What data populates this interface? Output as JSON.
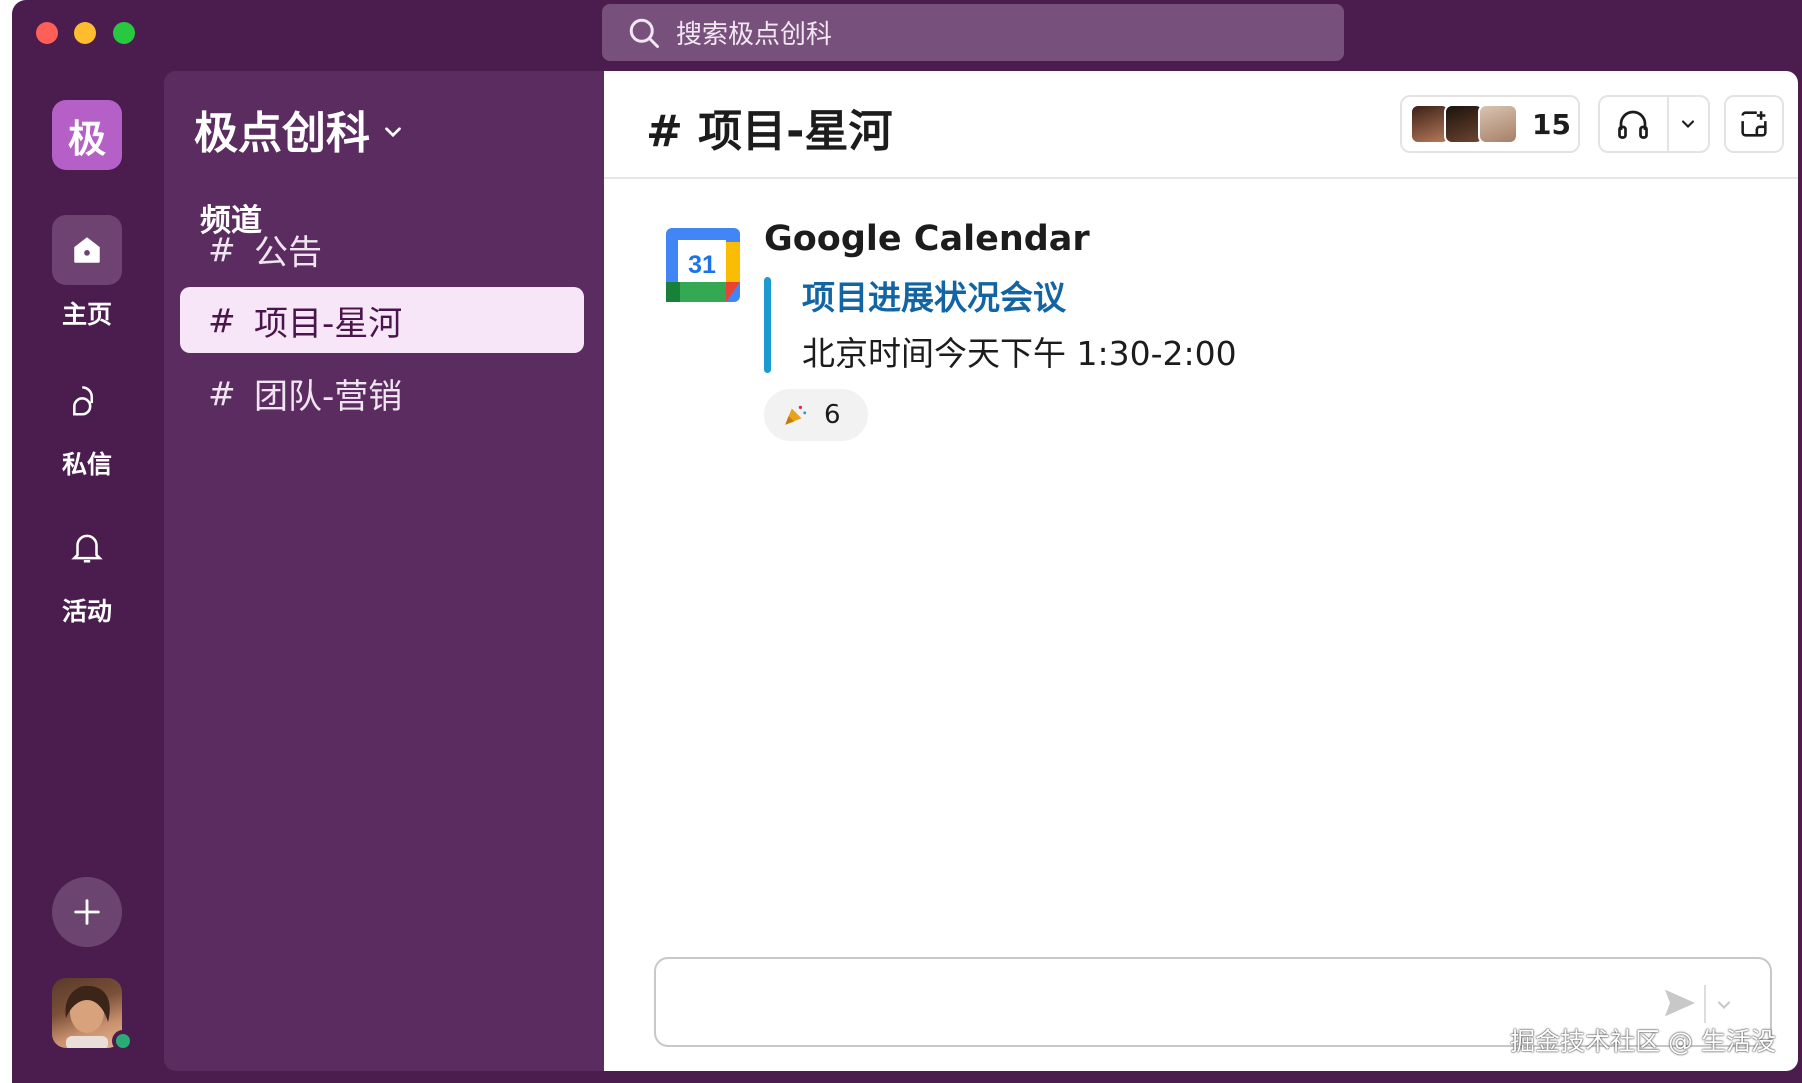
{
  "search": {
    "placeholder": "搜索极点创科"
  },
  "workspace": {
    "initial": "极",
    "name": "极点创科"
  },
  "rail": {
    "items": [
      {
        "label": "主页",
        "icon": "home-icon",
        "active": true
      },
      {
        "label": "私信",
        "icon": "messages-icon",
        "active": false
      },
      {
        "label": "活动",
        "icon": "bell-icon",
        "active": false
      }
    ]
  },
  "sidebar": {
    "section_title": "频道",
    "channels": [
      {
        "hash": "#",
        "name": "公告",
        "active": false
      },
      {
        "hash": "#",
        "name": "项目-星河",
        "active": true
      },
      {
        "hash": "#",
        "name": "团队-营销",
        "active": false
      }
    ]
  },
  "header": {
    "title": "# 项目-星河",
    "member_count": "15"
  },
  "message": {
    "sender": "Google Calendar",
    "app_icon_text": "31",
    "event_title": "项目进展状况会议",
    "event_time": "北京时间今天下午 1:30-2:00",
    "reaction": {
      "emoji": "party-popper-icon",
      "count": "6"
    }
  },
  "watermark": "掘金技术社区 @ 生活没",
  "colors": {
    "rail_bg": "#4a1d4e",
    "sidebar_bg": "#5a2c5f",
    "active_channel_bg": "#f6e6f8",
    "link": "#1264a3",
    "attachment_bar": "#1d9bd1",
    "presence": "#2bac76"
  }
}
